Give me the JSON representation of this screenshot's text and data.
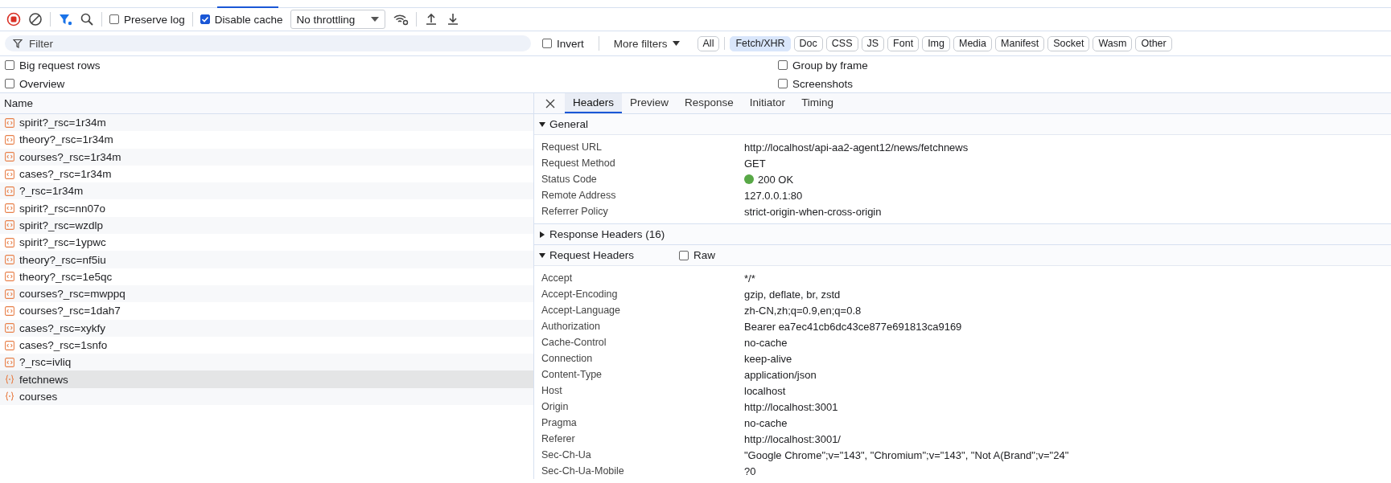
{
  "toolbar": {
    "preserve_log": {
      "label": "Preserve log",
      "checked": false
    },
    "disable_cache": {
      "label": "Disable cache",
      "checked": true
    },
    "throttling": "No throttling"
  },
  "filter": {
    "placeholder": "Filter",
    "invert": {
      "label": "Invert",
      "checked": false
    },
    "more_filters": "More filters",
    "types": [
      {
        "label": "All",
        "selected": false
      },
      {
        "label": "Fetch/XHR",
        "selected": true
      },
      {
        "label": "Doc",
        "selected": false
      },
      {
        "label": "CSS",
        "selected": false
      },
      {
        "label": "JS",
        "selected": false
      },
      {
        "label": "Font",
        "selected": false
      },
      {
        "label": "Img",
        "selected": false
      },
      {
        "label": "Media",
        "selected": false
      },
      {
        "label": "Manifest",
        "selected": false
      },
      {
        "label": "Socket",
        "selected": false
      },
      {
        "label": "Wasm",
        "selected": false
      },
      {
        "label": "Other",
        "selected": false
      }
    ]
  },
  "options": [
    {
      "label": "Big request rows",
      "checked": false
    },
    {
      "label": "Group by frame",
      "checked": false
    },
    {
      "label": "Overview",
      "checked": false
    },
    {
      "label": "Screenshots",
      "checked": false
    }
  ],
  "requests": {
    "column": "Name",
    "rows": [
      {
        "name": "spirit?_rsc=1r34m",
        "kind": "document",
        "selected": false
      },
      {
        "name": "theory?_rsc=1r34m",
        "kind": "document",
        "selected": false
      },
      {
        "name": "courses?_rsc=1r34m",
        "kind": "document",
        "selected": false
      },
      {
        "name": "cases?_rsc=1r34m",
        "kind": "document",
        "selected": false
      },
      {
        "name": "?_rsc=1r34m",
        "kind": "document",
        "selected": false
      },
      {
        "name": "spirit?_rsc=nn07o",
        "kind": "document",
        "selected": false
      },
      {
        "name": "spirit?_rsc=wzdlp",
        "kind": "document",
        "selected": false
      },
      {
        "name": "spirit?_rsc=1ypwc",
        "kind": "document",
        "selected": false
      },
      {
        "name": "theory?_rsc=nf5iu",
        "kind": "document",
        "selected": false
      },
      {
        "name": "theory?_rsc=1e5qc",
        "kind": "document",
        "selected": false
      },
      {
        "name": "courses?_rsc=mwppq",
        "kind": "document",
        "selected": false
      },
      {
        "name": "courses?_rsc=1dah7",
        "kind": "document",
        "selected": false
      },
      {
        "name": "cases?_rsc=xykfy",
        "kind": "document",
        "selected": false
      },
      {
        "name": "cases?_rsc=1snfo",
        "kind": "document",
        "selected": false
      },
      {
        "name": "?_rsc=ivliq",
        "kind": "document",
        "selected": false
      },
      {
        "name": "fetchnews",
        "kind": "fetch",
        "selected": true
      },
      {
        "name": "courses",
        "kind": "fetch",
        "selected": false
      }
    ]
  },
  "details": {
    "tabs": [
      {
        "label": "Headers",
        "selected": true
      },
      {
        "label": "Preview",
        "selected": false
      },
      {
        "label": "Response",
        "selected": false
      },
      {
        "label": "Initiator",
        "selected": false
      },
      {
        "label": "Timing",
        "selected": false
      }
    ],
    "sections": [
      {
        "title": "General",
        "expanded": true,
        "rows": [
          {
            "name": "Request URL",
            "value": "http://localhost/api-aa2-agent12/news/fetchnews",
            "kind": "text"
          },
          {
            "name": "Request Method",
            "value": "GET",
            "kind": "text"
          },
          {
            "name": "Status Code",
            "value": "200 OK",
            "kind": "status"
          },
          {
            "name": "Remote Address",
            "value": "127.0.0.1:80",
            "kind": "text"
          },
          {
            "name": "Referrer Policy",
            "value": "strict-origin-when-cross-origin",
            "kind": "text"
          }
        ]
      },
      {
        "title": "Response Headers (16)",
        "expanded": false
      },
      {
        "title": "Request Headers",
        "expanded": true,
        "raw": {
          "label": "Raw",
          "checked": false
        },
        "rows": [
          {
            "name": "Accept",
            "value": "*/*",
            "kind": "text"
          },
          {
            "name": "Accept-Encoding",
            "value": "gzip, deflate, br, zstd",
            "kind": "text"
          },
          {
            "name": "Accept-Language",
            "value": "zh-CN,zh;q=0.9,en;q=0.8",
            "kind": "text"
          },
          {
            "name": "Authorization",
            "value": "Bearer ea7ec41cb6dc43ce877e691813ca9169",
            "kind": "text"
          },
          {
            "name": "Cache-Control",
            "value": "no-cache",
            "kind": "text"
          },
          {
            "name": "Connection",
            "value": "keep-alive",
            "kind": "text"
          },
          {
            "name": "Content-Type",
            "value": "application/json",
            "kind": "text"
          },
          {
            "name": "Host",
            "value": "localhost",
            "kind": "text"
          },
          {
            "name": "Origin",
            "value": "http://localhost:3001",
            "kind": "text"
          },
          {
            "name": "Pragma",
            "value": "no-cache",
            "kind": "text"
          },
          {
            "name": "Referer",
            "value": "http://localhost:3001/",
            "kind": "text"
          },
          {
            "name": "Sec-Ch-Ua",
            "value": "\"Google Chrome\";v=\"143\", \"Chromium\";v=\"143\", \"Not A(Brand\";v=\"24\"",
            "kind": "text"
          },
          {
            "name": "Sec-Ch-Ua-Mobile",
            "value": "?0",
            "kind": "text"
          }
        ]
      }
    ]
  }
}
